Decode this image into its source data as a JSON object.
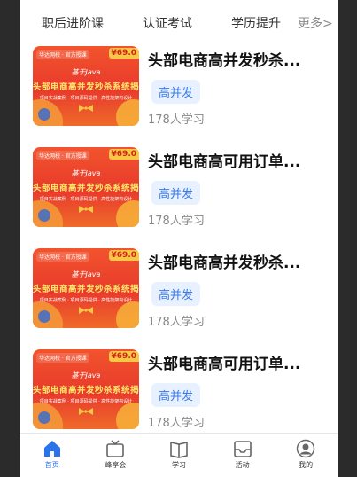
{
  "top_tabs": [
    "职后进阶课",
    "认证考试",
    "学历提升"
  ],
  "more_label": "更多>",
  "courses": [
    {
      "title": "头部电商高并发秒杀...",
      "tag": "高并发",
      "learners": "178人学习",
      "thumb": {
        "logo": "华达网校 · 官方授课",
        "price": "¥69.0",
        "java": "基于Java",
        "headline": "头部电商高并发秒杀系统揭秘",
        "sub": "项目实战案例 · 项目源码提供 · 高性能架构设计"
      }
    },
    {
      "title": "头部电商高可用订单...",
      "tag": "高并发",
      "learners": "178人学习",
      "thumb": {
        "logo": "华达网校 · 官方授课",
        "price": "¥69.0",
        "java": "基于Java",
        "headline": "头部电商高并发秒杀系统揭秘",
        "sub": "项目实战案例 · 项目源码提供 · 高性能架构设计"
      }
    },
    {
      "title": "头部电商高并发秒杀...",
      "tag": "高并发",
      "learners": "178人学习",
      "thumb": {
        "logo": "华达网校 · 官方授课",
        "price": "¥69.0",
        "java": "基于Java",
        "headline": "头部电商高并发秒杀系统揭秘",
        "sub": "项目实战案例 · 项目源码提供 · 高性能架构设计"
      }
    },
    {
      "title": "头部电商高可用订单...",
      "tag": "高并发",
      "learners": "178人学习",
      "thumb": {
        "logo": "华达网校 · 官方授课",
        "price": "¥69.0",
        "java": "基于Java",
        "headline": "头部电商高并发秒杀系统揭秘",
        "sub": "项目实战案例 · 项目源码提供 · 高性能架构设计"
      }
    }
  ],
  "tabbar": [
    {
      "label": "首页",
      "icon": "home-icon",
      "active": true
    },
    {
      "label": "峰享会",
      "icon": "tv-icon",
      "active": false
    },
    {
      "label": "学习",
      "icon": "book-icon",
      "active": false
    },
    {
      "label": "活动",
      "icon": "inbox-icon",
      "active": false
    },
    {
      "label": "我的",
      "icon": "profile-icon",
      "active": false
    }
  ],
  "colors": {
    "accent": "#2a73e8",
    "tag_bg": "#e8f1ff",
    "tag_text": "#3b7be8",
    "thumb_red": "#e83a2c"
  }
}
